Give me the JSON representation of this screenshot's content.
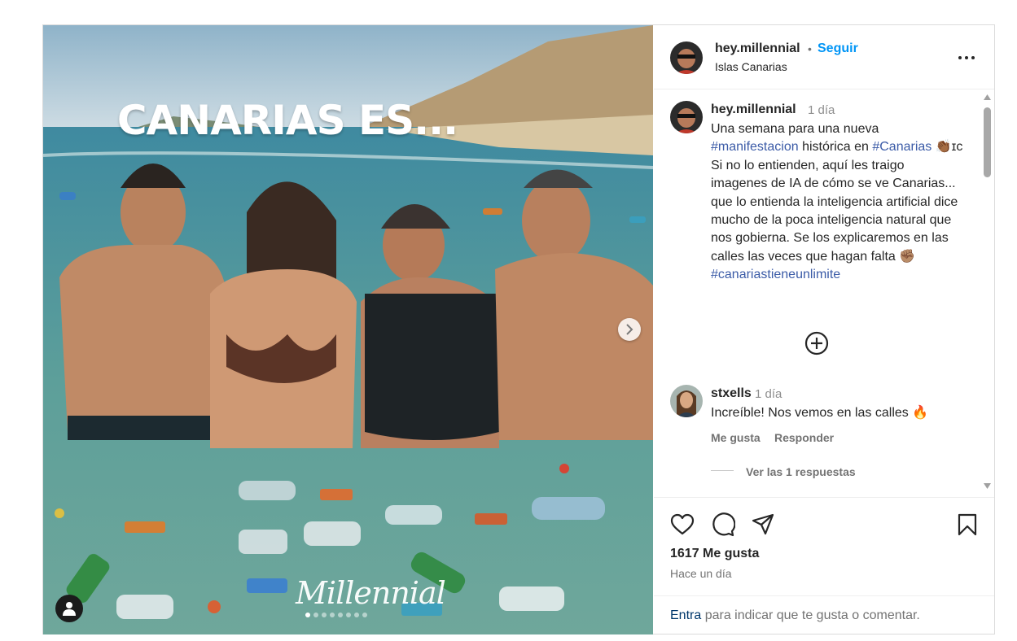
{
  "post": {
    "image_title": "CANARIAS ES...",
    "watermark": "Millennial",
    "slide_count": 8,
    "active_slide": 1
  },
  "header": {
    "username": "hey.millennial",
    "separator": "•",
    "follow_label": "Seguir",
    "location": "Islas Canarias"
  },
  "caption": {
    "username": "hey.millennial",
    "time": "1 día",
    "text_1": "Una semana para una nueva ",
    "hashtag_1": "#manifestacion",
    "text_2": " histórica en ",
    "hashtag_2": "#Canarias",
    "text_3": " 👏🏾ɪᴄ Si no lo entienden, aquí les traigo imagenes de IA de cómo se ve Canarias... que lo entienda la inteligencia artificial dice mucho de la poca inteligencia natural que nos gobierna. Se los explicaremos en las calles las veces que hagan falta ✊🏽",
    "hashtag_3": "#canariastieneunlimite"
  },
  "comment": {
    "username": "stxells",
    "time": "1 día",
    "text": "Increíble! Nos vemos en las calles 🔥",
    "like_label": "Me gusta",
    "reply_label": "Responder",
    "view_replies": "Ver las 1 respuestas"
  },
  "actions": {
    "likes": "1617 Me gusta",
    "posted": "Hace un día",
    "login_link": "Entra",
    "login_text": " para indicar que te gusta o comentar."
  },
  "colors": {
    "follow": "#0095f6",
    "hashtag": "#3b5ba7",
    "muted": "#737373"
  }
}
